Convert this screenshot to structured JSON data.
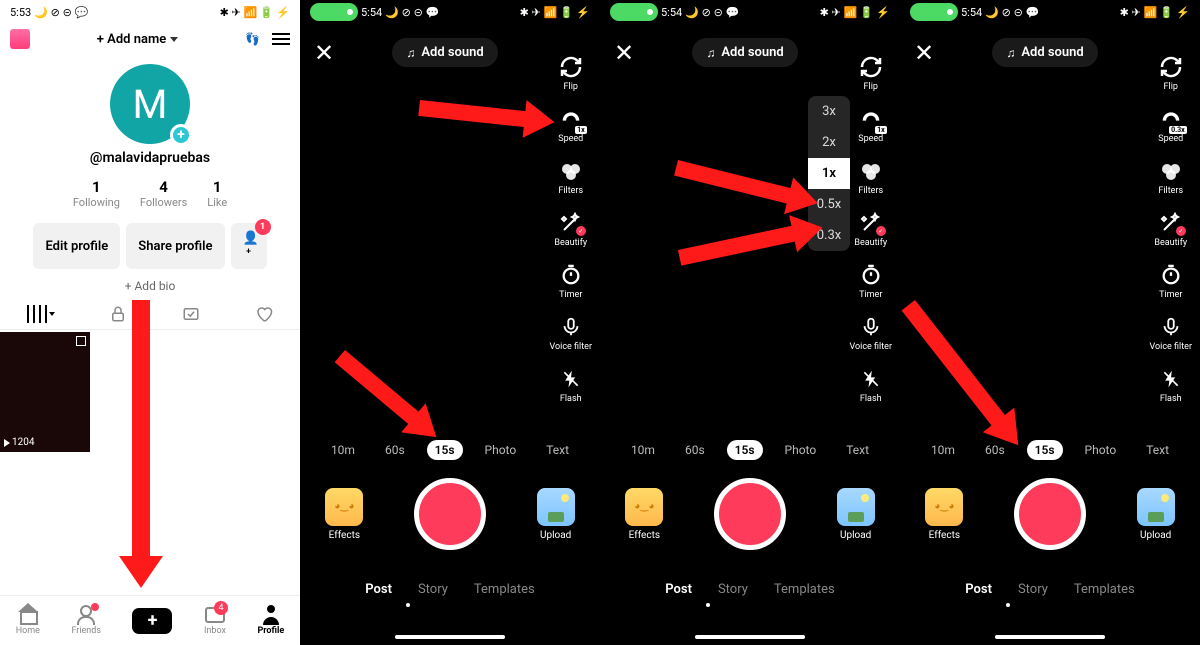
{
  "panel1": {
    "status": {
      "time": "5:53",
      "icons_l": "🌙 ⊘ ⊝ 💬",
      "icons_r": "✱ ✈ 📶 🔋 ⚡"
    },
    "add_name": "+ Add name",
    "avatar_letter": "M",
    "username": "@malavidapruebas",
    "stats": [
      {
        "num": "1",
        "lbl": "Following"
      },
      {
        "num": "4",
        "lbl": "Followers"
      },
      {
        "num": "1",
        "lbl": "Like"
      }
    ],
    "edit_profile": "Edit profile",
    "share_profile": "Share profile",
    "adduser_badge": "1",
    "add_bio": "+ Add bio",
    "video_views": "1204",
    "nav": {
      "home": "Home",
      "friends": "Friends",
      "inbox": "Inbox",
      "inbox_badge": "4",
      "profile": "Profile"
    }
  },
  "cam": {
    "status_time": "5:54",
    "status_icons_l": "🌙 ⊘ ⊝ 💬",
    "status_icons_r": "✱ ✈ 📶 🔋 ⚡",
    "add_sound": "Add sound",
    "tools": {
      "flip": "Flip",
      "speed": "Speed",
      "filters": "Filters",
      "beautify": "Beautify",
      "timer": "Timer",
      "voice": "Voice filter",
      "flash": "Flash"
    },
    "speed_1x": "1x",
    "speed_03x": "0.3x",
    "speed_options": [
      "3x",
      "2x",
      "1x",
      "0.5x",
      "0.3x"
    ],
    "durations": [
      "10m",
      "60s",
      "15s",
      "Photo",
      "Text"
    ],
    "effects": "Effects",
    "upload": "Upload",
    "modes": {
      "post": "Post",
      "story": "Story",
      "templates": "Templates"
    }
  }
}
